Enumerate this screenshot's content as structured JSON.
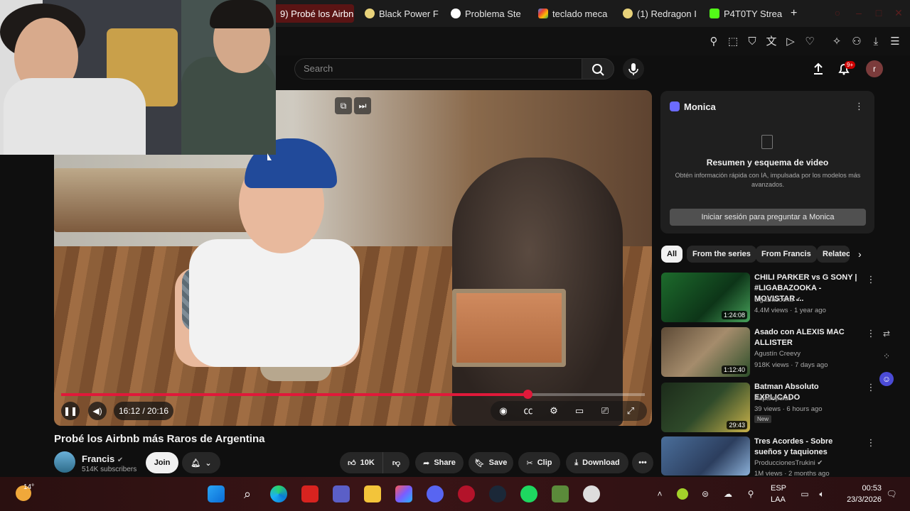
{
  "browser": {
    "tabs": [
      {
        "label": "9) Probé los Airbn",
        "active": true
      },
      {
        "label": "Black Power F"
      },
      {
        "label": "Problema Ste"
      },
      {
        "label": "teclado meca"
      },
      {
        "label": "(1) Redragon I"
      },
      {
        "label": "P4T0TY Strea"
      }
    ],
    "new_tab": "+"
  },
  "youtube": {
    "search_placeholder": "Search",
    "notifications_badge": "9+",
    "avatar_letter": "r"
  },
  "player": {
    "time_display": "16:12 / 20:16",
    "progress_fraction": 0.7985,
    "accent_color": "#e0193a"
  },
  "video": {
    "title": "Probé los Airbnb más Raros de Argentina",
    "channel": "Francis",
    "subscribers": "514K subscribers",
    "join_label": "Join",
    "likes": "10K",
    "share_label": "Share",
    "save_label": "Save",
    "clip_label": "Clip",
    "download_label": "Download"
  },
  "monica": {
    "title": "Monica",
    "heading": "Resumen y esquema de video",
    "description": "Obtén información rápida con IA, impulsada por los modelos más avanzados.",
    "button": "Iniciar sesión para preguntar a Monica"
  },
  "chips": [
    "All",
    "From the series",
    "From Francis",
    "Relatec"
  ],
  "recommendations": [
    {
      "title": "CHILI PARKER vs G SONY | #LIGABAZOOKA - MOVISTAR ...",
      "channel": "LigaBazooka",
      "meta": "4.4M views · 1 year ago",
      "duration": "1:24:08"
    },
    {
      "title": "Asado con ALEXIS MAC ALLISTER",
      "channel": "Agustín Creevy",
      "meta": "918K views · 7 days ago",
      "duration": "1:12:40"
    },
    {
      "title": "Batman Absoluto EXPLICADO",
      "channel": "Papalopulus",
      "meta": "39 views · 6 hours ago",
      "duration": "29:43",
      "badge": "New"
    },
    {
      "title": "Tres Acordes - Sobre sueños y taquiones",
      "channel": "ProduccionesTrukini",
      "meta": "1M views · 2 months ago",
      "duration": ""
    }
  ],
  "taskbar": {
    "weather": "14°",
    "lang_top": "ESP",
    "lang_bottom": "LAA",
    "time": "00:53",
    "date": "23/3/2026"
  }
}
